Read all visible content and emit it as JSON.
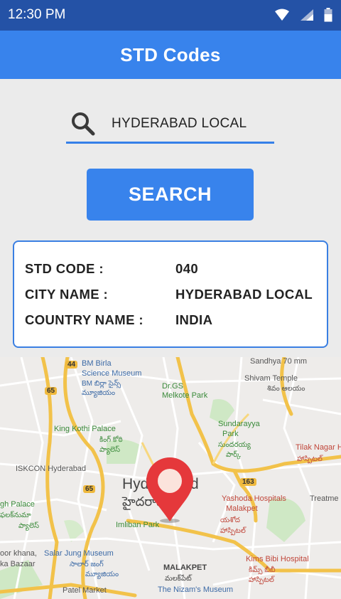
{
  "status_bar": {
    "time": "12:30 PM"
  },
  "app_bar": {
    "title": "STD Codes"
  },
  "search": {
    "value": "HYDERABAD LOCAL",
    "button_label": "SEARCH"
  },
  "result": {
    "std_code_label": "STD CODE :",
    "std_code_value": "040",
    "city_label": "CITY NAME :",
    "city_value": "HYDERABAD LOCAL",
    "country_label": "COUNTRY NAME :",
    "country_value": "INDIA"
  },
  "map": {
    "labels": {
      "bm_birla": "BM Birla",
      "science_museum": "Science Museum",
      "bm_birla_te": "BM బిర్లా సైన్స్",
      "museum_te": "మ్యూజియం",
      "sandhya": "Sandhya 70 mm",
      "shivam_temple": "Shivam Temple",
      "shivam_te": "శివం ఆలయం",
      "dr_gs": "Dr.GS",
      "melkote_park": "Melkote Park",
      "sundarayya": "Sundarayya",
      "park": "Park",
      "sundarayya_te": "సుందరయ్య",
      "park_te": "పార్క్",
      "king_kothi": "King Kothi Palace",
      "king_kothi_te": "కింగ్ కోఠి",
      "palace_te": "ప్యాలెస్",
      "tilak_nagar": "Tilak Nagar Hosp",
      "tilak_te": "హాస్పిటల్",
      "iskcon": "ISKCON Hyderabad",
      "hyd_partial": "Hyd",
      "hyd_tail": "d",
      "hyd_te": "హైదరాబాద్",
      "yashoda": "Yashoda Hospitals",
      "malakpet": "Malakpet",
      "yashoda_te": "యశోద",
      "hospitals_te": "హాస్పిటల్",
      "treatme": "Treatme",
      "gh_palace": "gh Palace",
      "gh_te": "ఫలక్‌నుమా",
      "palace2_te": "ప్యాలెస్",
      "imliban": "Imliban Park",
      "salar_jung": "Salar Jung Museum",
      "koor_khana": "oor khana,",
      "bazaar": "ka Bazaar",
      "salar_te": "సాలార్ జంగ్",
      "museum2_te": "మ్యూజియం",
      "kimbs": "Kims Bibi Hospital",
      "kimbs_te": "కిమ్స్ బీబీ",
      "hosp_te": "హాస్పిటల్",
      "malakpet2": "MALAKPET",
      "malakpet_te": "మలక్‌పేట్",
      "nizams": "The Nizam's Museum",
      "parl_market": "Patel Market",
      "road_44": "44",
      "road_65a": "65",
      "road_65b": "65",
      "road_163": "163"
    }
  }
}
